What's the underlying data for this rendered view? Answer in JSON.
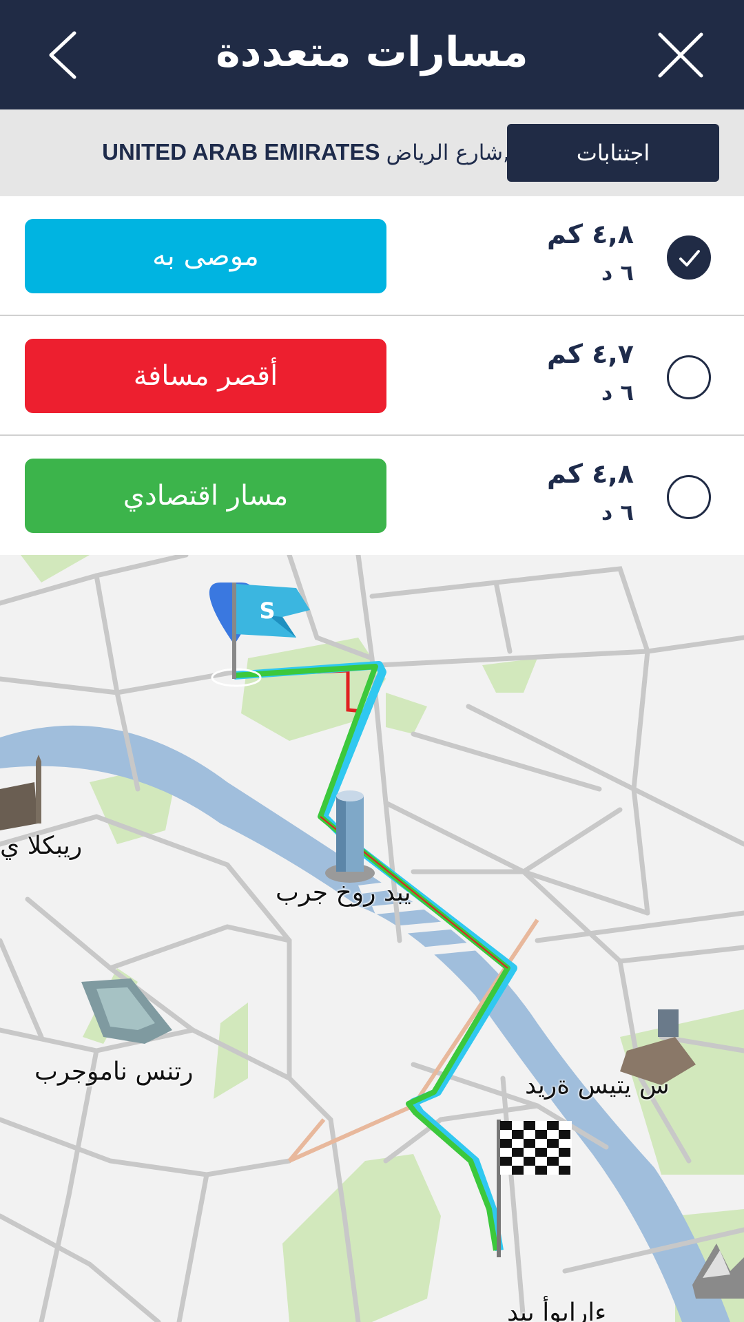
{
  "header": {
    "title": "مسارات متعددة",
    "background": "#202b45"
  },
  "destination": {
    "street": "شارع الرياض,",
    "country": "UNITED ARAB EMIRATES",
    "avoid_label": "اجتنابات"
  },
  "routes": [
    {
      "label": "موصى به",
      "distance": "٤,٨ كم",
      "time": "٦ د",
      "color": "#00b4e1",
      "selected": true
    },
    {
      "label": "أقصر مسافة",
      "distance": "٤,٧ كم",
      "time": "٦ د",
      "color": "#ed1f2f",
      "selected": false
    },
    {
      "label": "مسار اقتصادي",
      "distance": "٤,٨ كم",
      "time": "٦ د",
      "color": "#3cb44b",
      "selected": false
    }
  ],
  "map": {
    "labels": {
      "mosque": "ريبكلا ي",
      "tower": "يبد روخ جرب",
      "palace": "رتنس ناموجرب",
      "museum": "س يتيس ةريد",
      "opera": "ءارابوأ يبد"
    },
    "colors": {
      "water": "#a0bedc",
      "park": "#d2e8bc",
      "road": "#c8c8c8",
      "land": "#f2f2f2",
      "route_green": "#3cc83c"
    },
    "icons": [
      "start-flag-icon",
      "location-pin-icon",
      "finish-flag-icon",
      "mosque-icon",
      "tower-icon",
      "palace-icon",
      "museum-icon",
      "opera-icon"
    ]
  }
}
